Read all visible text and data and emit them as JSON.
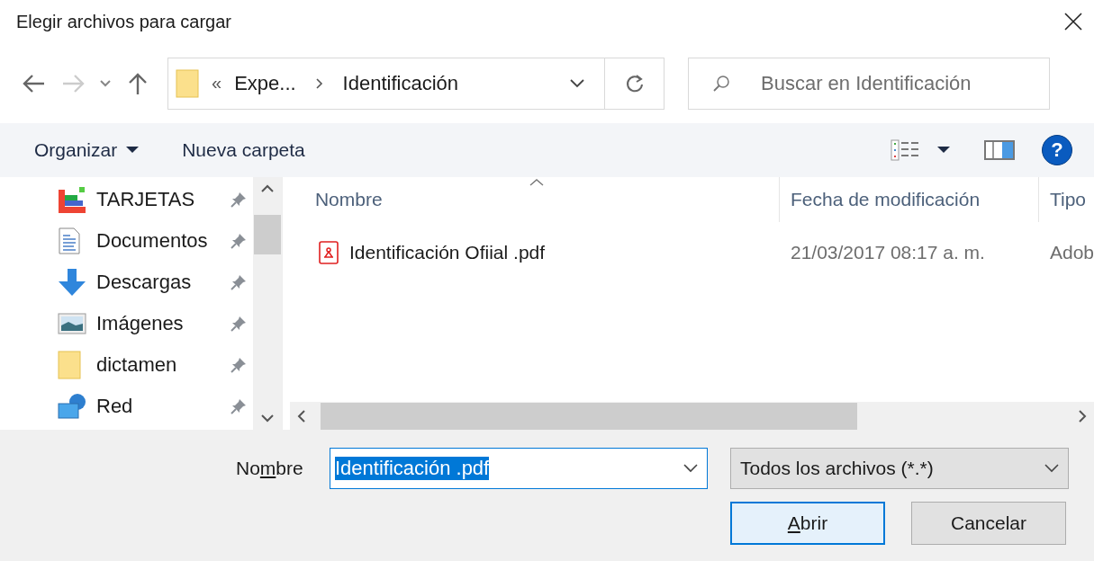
{
  "window": {
    "title": "Elegir archivos para cargar"
  },
  "address": {
    "overflow": "«",
    "crumbs": [
      "Expe...",
      "Identificación"
    ]
  },
  "search": {
    "placeholder": "Buscar en Identificación"
  },
  "toolbar": {
    "organize": "Organizar",
    "new_folder": "Nueva carpeta",
    "help": "?"
  },
  "sidebar": {
    "items": [
      {
        "label": "TARJETAS",
        "kind": "cards",
        "pinned": true
      },
      {
        "label": "Documentos",
        "kind": "documents",
        "pinned": true
      },
      {
        "label": "Descargas",
        "kind": "downloads",
        "pinned": true
      },
      {
        "label": "Imágenes",
        "kind": "pictures",
        "pinned": true
      },
      {
        "label": "dictamen",
        "kind": "folder",
        "pinned": true
      },
      {
        "label": "Red",
        "kind": "network",
        "pinned": true
      }
    ]
  },
  "table": {
    "columns": [
      "Nombre",
      "Fecha de modificación",
      "Tipo"
    ],
    "rows": [
      {
        "name": "Identificación Ofiial .pdf",
        "date": "21/03/2017 08:17 a. m.",
        "type": "Adob",
        "selected": false
      }
    ]
  },
  "filename": {
    "label": {
      "before": "No",
      "key": "m",
      "after": "bre"
    },
    "value": "Identificación .pdf"
  },
  "filetype": {
    "value": "Todos los archivos (*.*)"
  },
  "buttons": [
    {
      "key": "A",
      "after": "brir",
      "kind": "default"
    },
    {
      "before": "Cancelar",
      "kind": "normal"
    }
  ]
}
